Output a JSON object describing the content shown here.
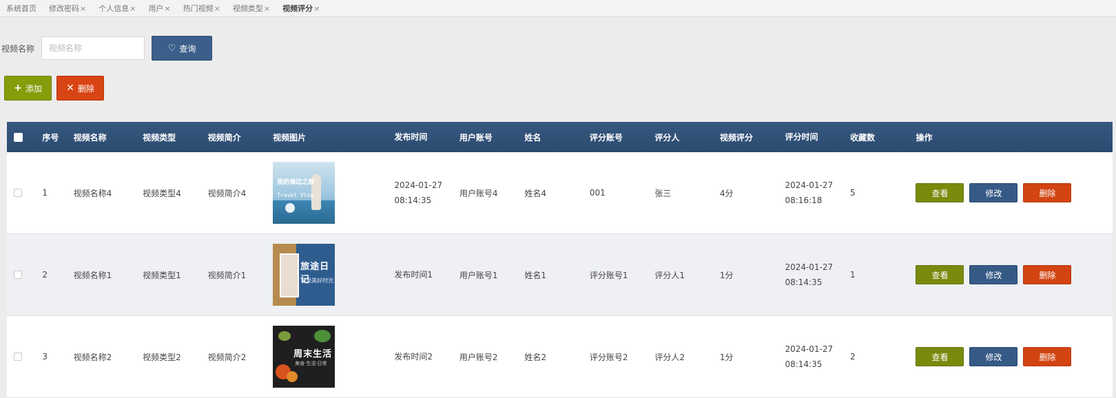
{
  "tabs": [
    {
      "label": "系统首页",
      "closable": false
    },
    {
      "label": "修改密码",
      "closable": true
    },
    {
      "label": "个人信息",
      "closable": true
    },
    {
      "label": "用户",
      "closable": true
    },
    {
      "label": "热门视频",
      "closable": true
    },
    {
      "label": "视频类型",
      "closable": true
    },
    {
      "label": "视频评分",
      "closable": true,
      "active": true
    }
  ],
  "tab_close_glyph": "×",
  "search": {
    "label": "视频名称",
    "placeholder": "视频名称",
    "value": "",
    "query_label": "查询",
    "query_icon": "heart-icon"
  },
  "actions": {
    "add_label": "添加",
    "add_icon": "plus-icon",
    "delete_label": "删除",
    "delete_icon": "close-icon"
  },
  "table": {
    "headers": [
      "序号",
      "视频名称",
      "视频类型",
      "视频简介",
      "视频图片",
      "发布时间",
      "用户账号",
      "姓名",
      "评分账号",
      "评分人",
      "视频评分",
      "评分时间",
      "收藏数",
      "操作"
    ],
    "rows": [
      {
        "idx": "1",
        "name": "视频名称4",
        "type": "视频类型4",
        "intro": "视频简介4",
        "image_text": [
          "我的海边之旅",
          "Travel Vlog"
        ],
        "pub_date": "2024-01-27",
        "pub_time": "08:14:35",
        "account": "用户账号4",
        "real_name": "姓名4",
        "rate_account": "001",
        "rater": "张三",
        "score": "4分",
        "rate_date": "2024-01-27",
        "rate_time": "08:16:18",
        "fav": "5"
      },
      {
        "idx": "2",
        "name": "视频名称1",
        "type": "视频类型1",
        "intro": "视频简介1",
        "image_text": [
          "旅途日记",
          "记录美好时光"
        ],
        "pub_date": "发布时间1",
        "pub_time": "",
        "account": "用户账号1",
        "real_name": "姓名1",
        "rate_account": "评分账号1",
        "rater": "评分人1",
        "score": "1分",
        "rate_date": "2024-01-27",
        "rate_time": "08:14:35",
        "fav": "1"
      },
      {
        "idx": "3",
        "name": "视频名称2",
        "type": "视频类型2",
        "intro": "视频简介2",
        "image_text": [
          "周末生活",
          "美食·生活·日常"
        ],
        "pub_date": "发布时间2",
        "pub_time": "",
        "account": "用户账号2",
        "real_name": "姓名2",
        "rate_account": "评分账号2",
        "rater": "评分人2",
        "score": "1分",
        "rate_date": "2024-01-27",
        "rate_time": "08:14:35",
        "fav": "2"
      }
    ],
    "row_actions": {
      "view": "查看",
      "edit": "修改",
      "delete": "删除"
    }
  },
  "colors": {
    "header_bg": "#2f5077",
    "query_button": "#3b5f8a",
    "add_button": "#879c0b",
    "delete_button": "#d94414",
    "view_button": "#7a8a0c",
    "edit_button": "#365a86",
    "row_delete_button": "#d24412"
  }
}
